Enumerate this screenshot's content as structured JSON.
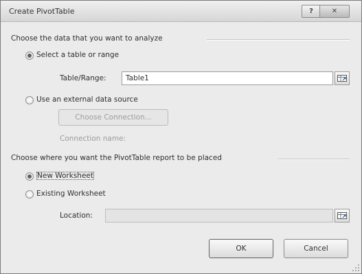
{
  "dialog": {
    "title": "Create PivotTable",
    "close_glyph": "✕",
    "help_glyph": "?"
  },
  "data_section": {
    "heading": "Choose the data that you want to analyze",
    "option_table": "Select a table or range",
    "table_range_label": "Table/Range:",
    "table_range_value": "Table1",
    "option_external": "Use an external data source",
    "choose_connection_button": "Choose Connection...",
    "connection_name_label": "Connection name:"
  },
  "placement_section": {
    "heading": "Choose where you want the PivotTable report to be placed",
    "option_new": "New Worksheet",
    "option_existing": "Existing Worksheet",
    "location_label": "Location:",
    "location_value": ""
  },
  "buttons": {
    "ok": "OK",
    "cancel": "Cancel"
  },
  "icons": {
    "range_picker": "range-picker-icon"
  },
  "state": {
    "data_source": "table",
    "placement": "new"
  }
}
